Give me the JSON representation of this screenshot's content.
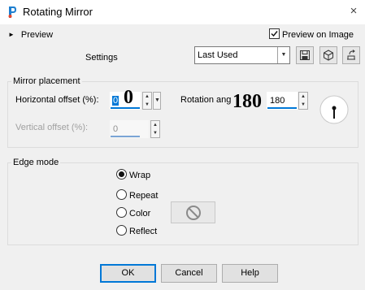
{
  "window": {
    "title": "Rotating Mirror",
    "close_glyph": "×",
    "icon": "app-logo-icon"
  },
  "preview": {
    "toggle_label": "Preview",
    "arrow_glyph": "►",
    "on_image_label": "Preview on Image",
    "on_image_checked": true
  },
  "settings": {
    "label": "Settings",
    "preset_value": "Last Used",
    "preset_arrow": "▼",
    "buttons": [
      "save-preset-icon",
      "preset-manager-icon",
      "reset-default-icon"
    ]
  },
  "mirror_placement": {
    "group_label": "Mirror placement",
    "horizontal_offset_label": "Horizontal offset (%):",
    "horizontal_offset_value": "0",
    "horizontal_offset_overlay": "0",
    "rotation_angle_label": "Rotation angle:",
    "rotation_angle_value": "180",
    "rotation_angle_overlay": "180",
    "vertical_offset_label": "Vertical offset (%):",
    "vertical_offset_value": "0",
    "vertical_offset_enabled": false
  },
  "edge_mode": {
    "group_label": "Edge mode",
    "options": [
      "Wrap",
      "Repeat",
      "Color",
      "Reflect"
    ],
    "selected": "Wrap"
  },
  "buttons": {
    "ok": "OK",
    "cancel": "Cancel",
    "help": "Help"
  },
  "colors": {
    "accent": "#0078d7",
    "background": "#f0f0f0"
  }
}
